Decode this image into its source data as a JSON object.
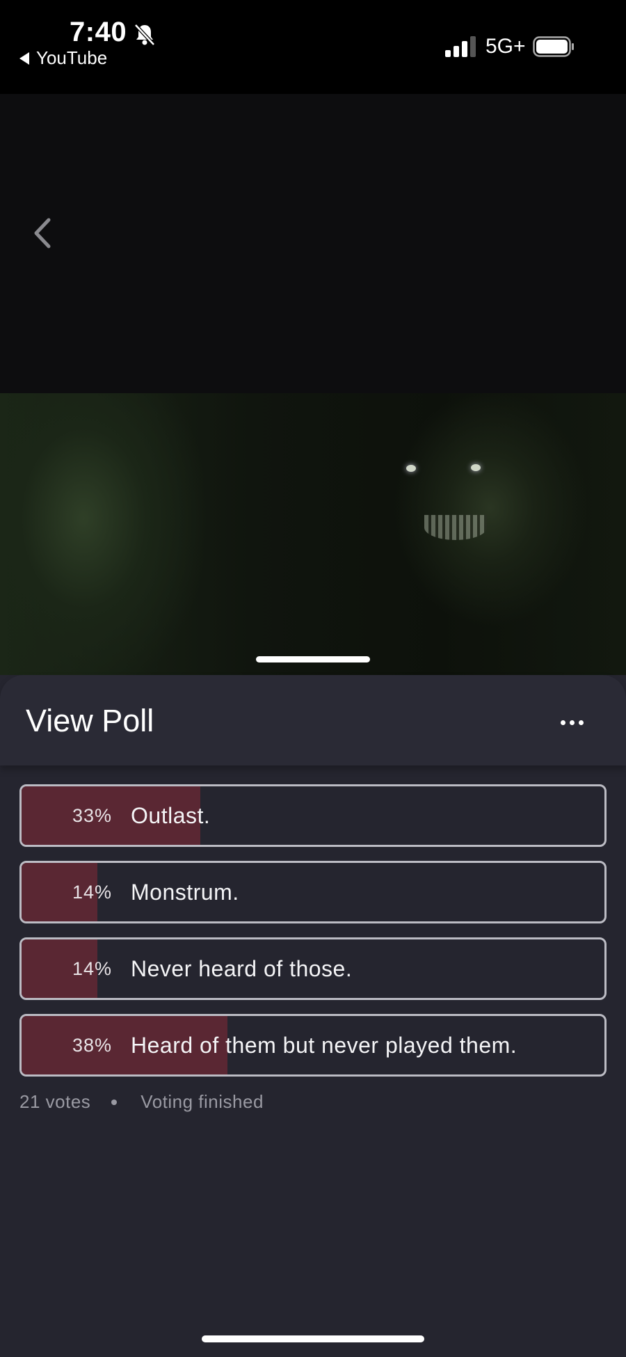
{
  "status_bar": {
    "time": "7:40",
    "back_app": "YouTube",
    "network": "5G+"
  },
  "sheet": {
    "title": "View Poll"
  },
  "poll": {
    "options": [
      {
        "percent": "33%",
        "label": "Outlast.",
        "fraction": 0.33
      },
      {
        "percent": "14%",
        "label": "Monstrum.",
        "fraction": 0.14
      },
      {
        "percent": "14%",
        "label": "Never heard of those.",
        "fraction": 0.14
      },
      {
        "percent": "38%",
        "label": "Heard of them but never played them.",
        "fraction": 0.38
      }
    ],
    "votes": "21 votes",
    "status": "Voting finished"
  },
  "colors": {
    "background": "#25252f",
    "result_fill": "#5a2733",
    "option_border": "#bcbcc4"
  },
  "icons": [
    "bell-slash-icon",
    "signal-icon",
    "battery-icon",
    "chevron-left-icon",
    "more-horizontal-icon"
  ]
}
